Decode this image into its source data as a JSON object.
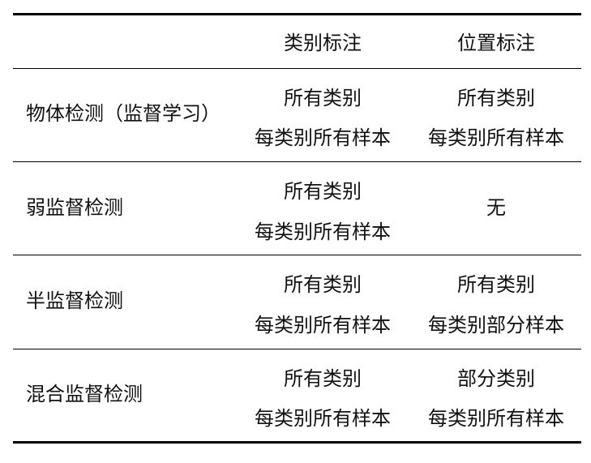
{
  "table": {
    "header": {
      "col1": "",
      "col2": "类别标注",
      "col3": "位置标注"
    },
    "rows": [
      {
        "name": "物体检测（监督学习）",
        "category": [
          "所有类别",
          "每类别所有样本"
        ],
        "position": [
          "所有类别",
          "每类别所有样本"
        ]
      },
      {
        "name": "弱监督检测",
        "category": [
          "所有类别",
          "每类别所有样本"
        ],
        "position": [
          "无"
        ]
      },
      {
        "name": "半监督检测",
        "category": [
          "所有类别",
          "每类别所有样本"
        ],
        "position": [
          "所有类别",
          "每类别部分样本"
        ]
      },
      {
        "name": "混合监督检测",
        "category": [
          "所有类别",
          "每类别所有样本"
        ],
        "position": [
          "部分类别",
          "每类别所有样本"
        ]
      }
    ]
  }
}
